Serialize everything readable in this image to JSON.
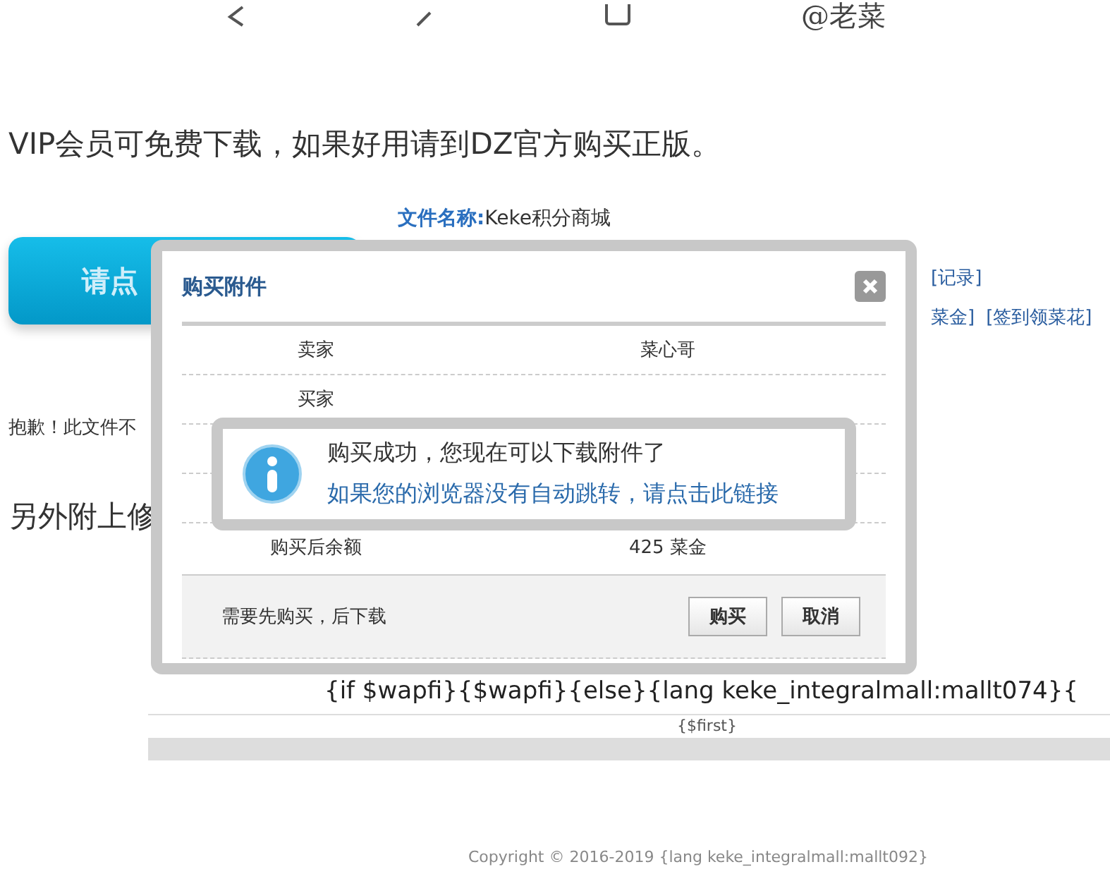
{
  "browser_toolbar": {
    "logo": "@老菜"
  },
  "notice": "VIP会员可免费下载，如果好用请到DZ官方购买正版。",
  "download_button": {
    "label": "请点"
  },
  "file_name": {
    "label": "文件名称:",
    "value": "Keke积分商城"
  },
  "links": [
    "[记录]",
    "菜金]",
    "[签到领菜花]"
  ],
  "apology": "抱歉！此文件不",
  "extra_note": "另外附上修",
  "template_line": "{if $wapfi}{$wapfi}{else}{lang keke_integralmall:mallt074}{",
  "template_first": "{$first}",
  "copyright": "Copyright © 2016-2019 {lang keke_integralmall:mallt092}",
  "dialog": {
    "title": "购买附件",
    "rows": [
      {
        "label": "卖家",
        "value": "菜心哥"
      },
      {
        "label": "买家"
      },
      {
        "label": "购买后余额",
        "value": "425 菜金"
      }
    ],
    "footer_note": "需要先购买，后下载",
    "buttons": [
      "购买",
      "取消"
    ]
  },
  "popup": {
    "message": "购买成功，您现在可以下载附件了",
    "link": "如果您的浏览器没有自动跳转，请点击此链接"
  }
}
